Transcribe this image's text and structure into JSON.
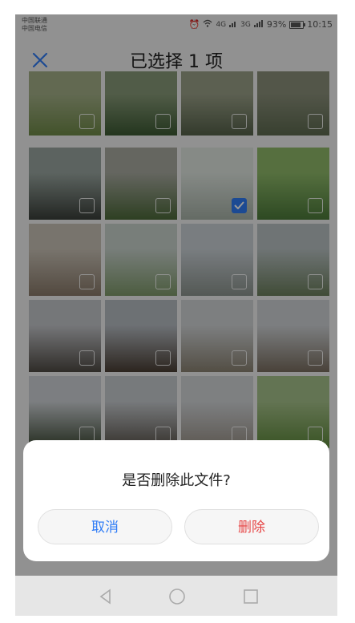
{
  "status_bar": {
    "carrier_1": "中国联通",
    "carrier_2": "中国电信",
    "network_1": "4G",
    "network_2": "3G",
    "battery_pct": "93%",
    "time": "10:15"
  },
  "header": {
    "title": "已选择 1 项",
    "close_icon": "close-icon"
  },
  "grid": {
    "rows": 5,
    "cols": 4,
    "selected_index": 6,
    "thumb_colors": [
      [
        "#6f8a48",
        "#a4b088"
      ],
      [
        "#3c5a33",
        "#889a78"
      ],
      [
        "#56624a",
        "#9aa088"
      ],
      [
        "#5e6b50",
        "#8a8f7a"
      ],
      [
        "#3a3f3a",
        "#9aa6a0"
      ],
      [
        "#4d6a3a",
        "#a8aaa0"
      ],
      [
        "#a8b3a8",
        "#dfe6e0"
      ],
      [
        "#4c7a3a",
        "#8fba6a"
      ],
      [
        "#8a7a6a",
        "#c9c2b6"
      ],
      [
        "#7f9a6a",
        "#c8d2cc"
      ],
      [
        "#8c948e",
        "#cad1d6"
      ],
      [
        "#6c7f5d",
        "#b9c2c3"
      ],
      [
        "#4f4a44",
        "#c4c6ca"
      ],
      [
        "#4a3e34",
        "#b6bcc2"
      ],
      [
        "#8a8272",
        "#d1d4d6"
      ],
      [
        "#7a6e60",
        "#cfd3d6"
      ],
      [
        "#3d4a35",
        "#cfd3d7"
      ],
      [
        "#5a544c",
        "#c7cbcf"
      ],
      [
        "#9a9288",
        "#d2d5d8"
      ],
      [
        "#5f8a3c",
        "#a6c28a"
      ]
    ]
  },
  "dialog": {
    "message": "是否删除此文件?",
    "cancel_label": "取消",
    "delete_label": "删除"
  },
  "nav_bar": {
    "back_icon": "back-icon",
    "home_icon": "home-icon",
    "recents_icon": "recents-icon"
  },
  "colors": {
    "accent": "#2f7cf6",
    "danger": "#e64545"
  }
}
